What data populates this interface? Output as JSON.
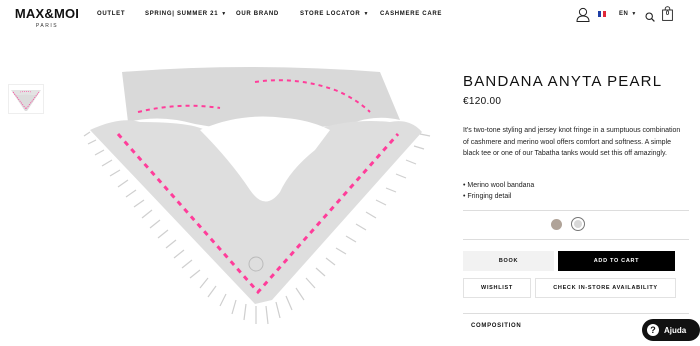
{
  "header": {
    "logo": "MAX&MOI",
    "logo_sub": "PARIS",
    "nav": [
      {
        "label": "OUTLET",
        "has_caret": false
      },
      {
        "label": "SPRING| SUMMER 21",
        "has_caret": true
      },
      {
        "label": "OUR BRAND",
        "has_caret": false
      },
      {
        "label": "STORE LOCATOR",
        "has_caret": true
      },
      {
        "label": "CASHMERE CARE",
        "has_caret": false
      }
    ],
    "language": "EN",
    "cart_count": "0",
    "icons": [
      "user-icon",
      "flag-fr-icon",
      "search-icon",
      "bag-icon"
    ]
  },
  "product": {
    "title": "BANDANA ANYTA PEARL",
    "price": "€120.00",
    "description": "It's two-tone styling and jersey knot fringe in a sumptuous combination of cashmere and merino wool offers comfort and softness. A simple black tee or one of our Tabatha tanks would set this off amazingly.",
    "bullets": [
      "• Merino wool bandana",
      "• Fringing detail"
    ],
    "colors": {
      "swatch_taupe": "#b0a398",
      "swatch_pearl": "#d9d9d9",
      "accent_pink": "#ff3d9a",
      "knit_grey": "#dcdcdc"
    }
  },
  "actions": {
    "book": "BOOK",
    "add_to_cart": "ADD TO CART",
    "wishlist": "WISHLIST",
    "check_store": "CHECK IN-STORE AVAILABILITY"
  },
  "accordion": {
    "composition": "COMPOSITION"
  },
  "help_widget": {
    "label": "Ajuda"
  }
}
